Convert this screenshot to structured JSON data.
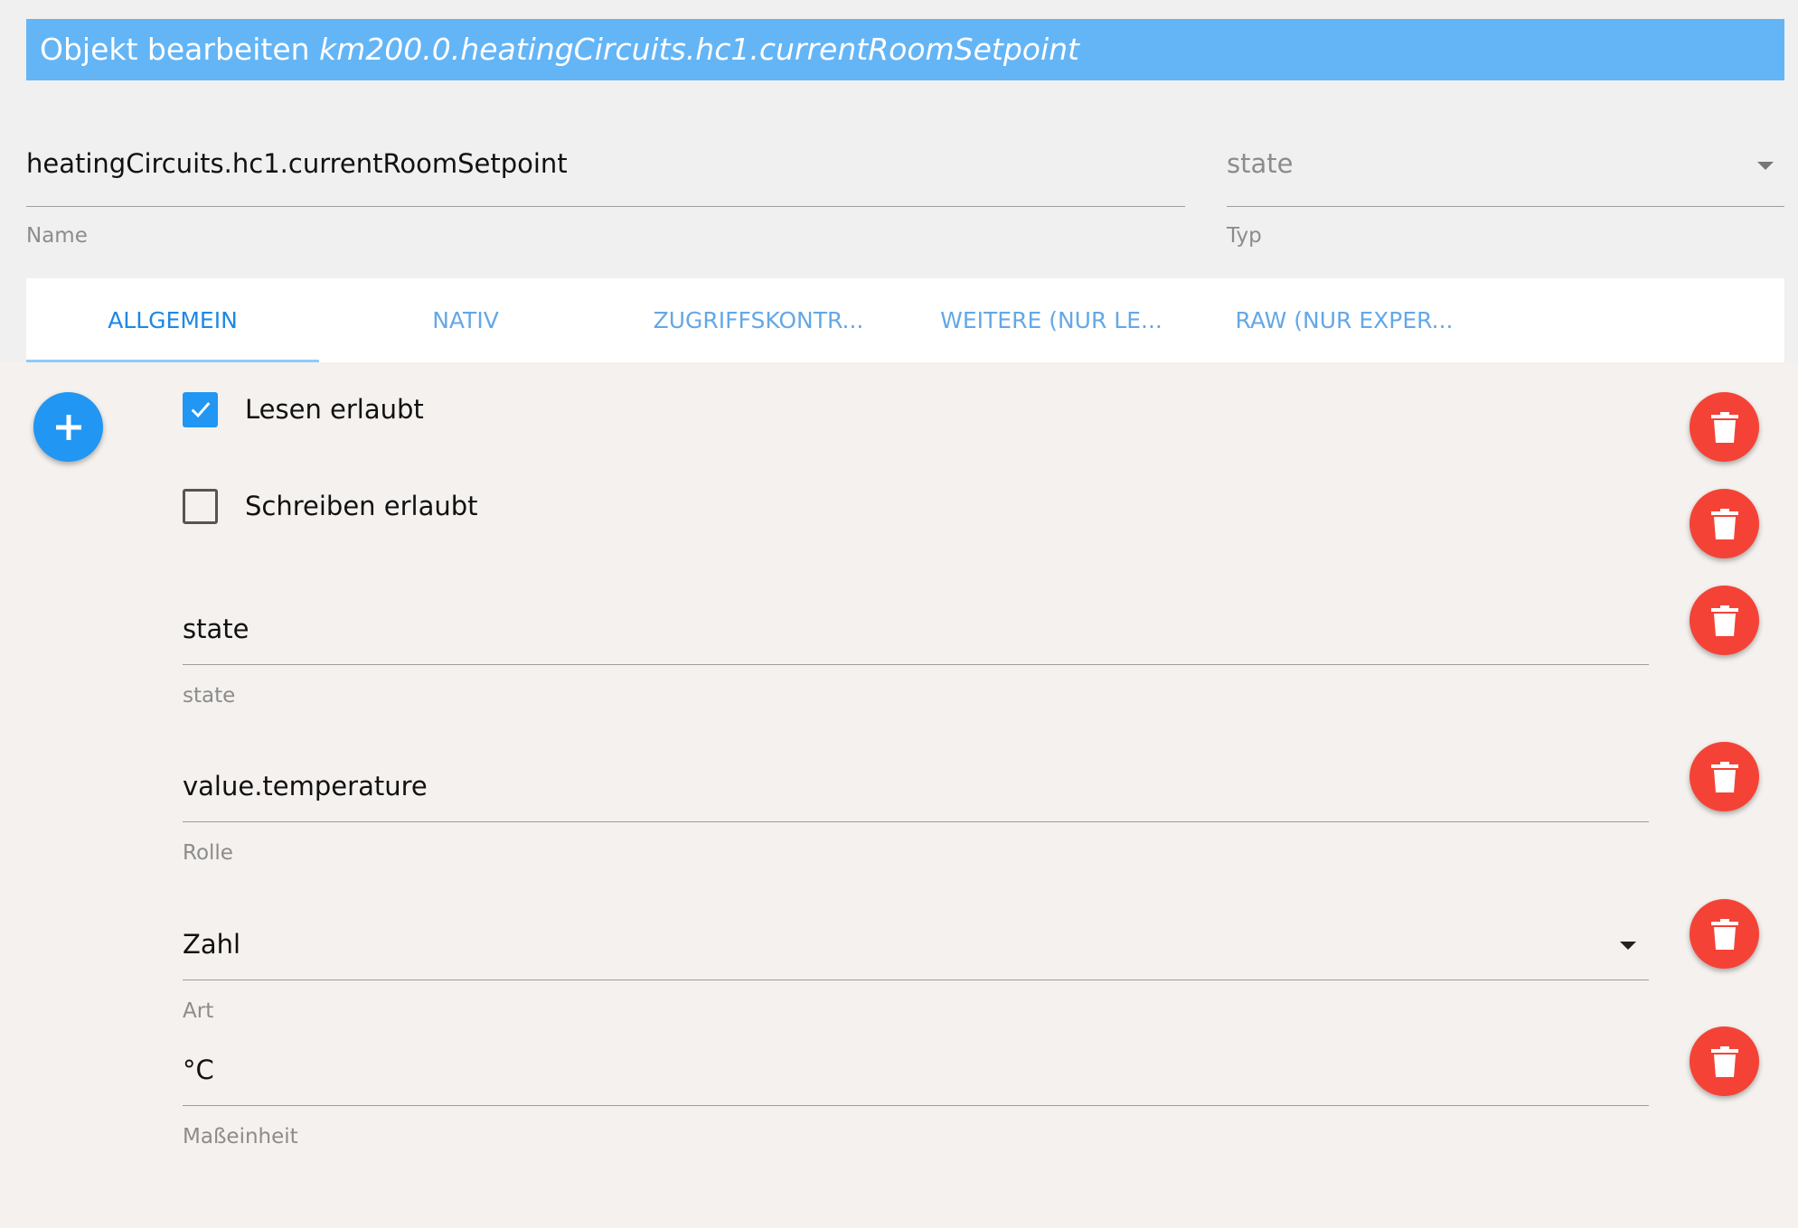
{
  "header": {
    "title_prefix": "Objekt bearbeiten",
    "object_id": "km200.0.heatingCircuits.hc1.currentRoomSetpoint"
  },
  "name_field": {
    "value": "heatingCircuits.hc1.currentRoomSetpoint",
    "label": "Name"
  },
  "type_field": {
    "value": "state",
    "label": "Typ"
  },
  "tabs": [
    {
      "label": "ALLGEMEIN",
      "active": true
    },
    {
      "label": "NATIV"
    },
    {
      "label": "ZUGRIFFSKONTR..."
    },
    {
      "label": "WEITERE (NUR LE..."
    },
    {
      "label": "RAW (NUR EXPER..."
    }
  ],
  "general": {
    "read": {
      "label": "Lesen erlaubt",
      "checked": true
    },
    "write": {
      "label": "Schreiben erlaubt",
      "checked": false
    },
    "fields": [
      {
        "value": "state",
        "label": "state"
      },
      {
        "value": "value.temperature",
        "label": "Rolle"
      },
      {
        "value": "Zahl",
        "label": "Art",
        "dropdown": true
      },
      {
        "value": "°C",
        "label": "Maßeinheit"
      }
    ]
  },
  "icons": {
    "add": "plus-icon",
    "delete": "trash-icon",
    "check": "check-icon",
    "dropdown": "caret-down-icon"
  },
  "colors": {
    "header_bg": "#64b5f6",
    "primary": "#2196f3",
    "danger": "#f44336",
    "tab_active": "#1e88e5"
  }
}
